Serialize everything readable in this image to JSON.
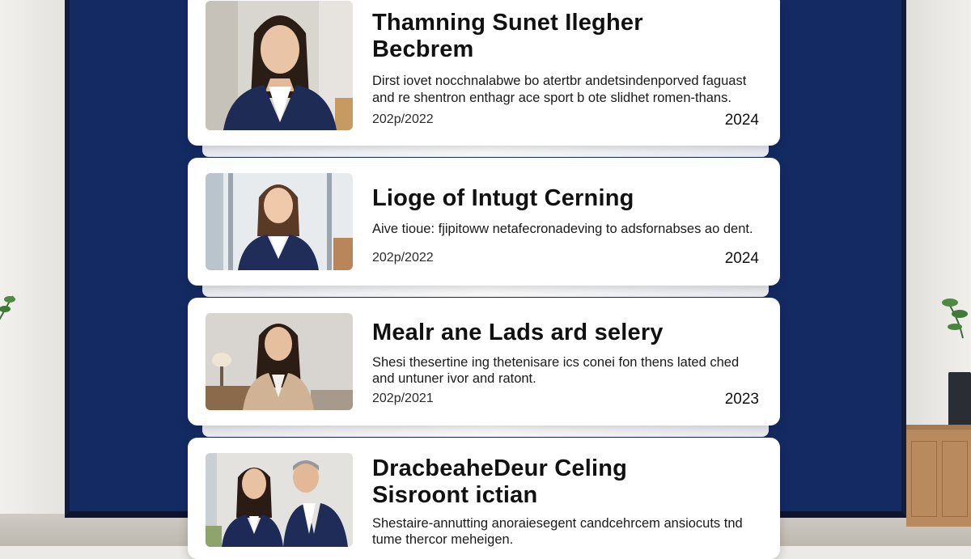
{
  "cards": [
    {
      "title_line1": "Thamning Sunet Ilegher",
      "title_line2": "Becbrem",
      "desc_line1": "Dirst iovet nocchnalabwe bo atertbr andetsindenporved faguast",
      "desc_line2": "and re shentron enthagr ace sport b ote slidhet romen-thans.",
      "date_range": "202p/2022",
      "year": "2024",
      "photo": "portrait-woman-navy-blazer"
    },
    {
      "title_line1": "Lioge of Intugt Cerning",
      "desc_line1": "Aive tioue: fjipitoww netafecronadeving to adsfornabses ao dent.",
      "date_range": "202p/2022",
      "year": "2024",
      "photo": "portrait-woman-office-windows"
    },
    {
      "title_line1": "Mealr ane Lads ard selery",
      "desc_line1": "Shesi thesertine ing thetenisare ics conei fon thens lated ched",
      "desc_line2": "and untuner ivor and ratont.",
      "date_range": "202p/2021",
      "year": "2023",
      "photo": "portrait-woman-beige-blazer"
    },
    {
      "title_line1": "DracbeaheDeur Celing",
      "title_line2": "Sisroont ictian",
      "desc_line1": "Shestaire-annutting anoraiesegent candcehrcem ansiocuts tnd",
      "desc_line2": "tume thercor meheigen.",
      "photo": "portrait-two-colleagues"
    }
  ],
  "colors": {
    "panel": "#142a63",
    "card": "#ffffff",
    "text": "#111111"
  }
}
